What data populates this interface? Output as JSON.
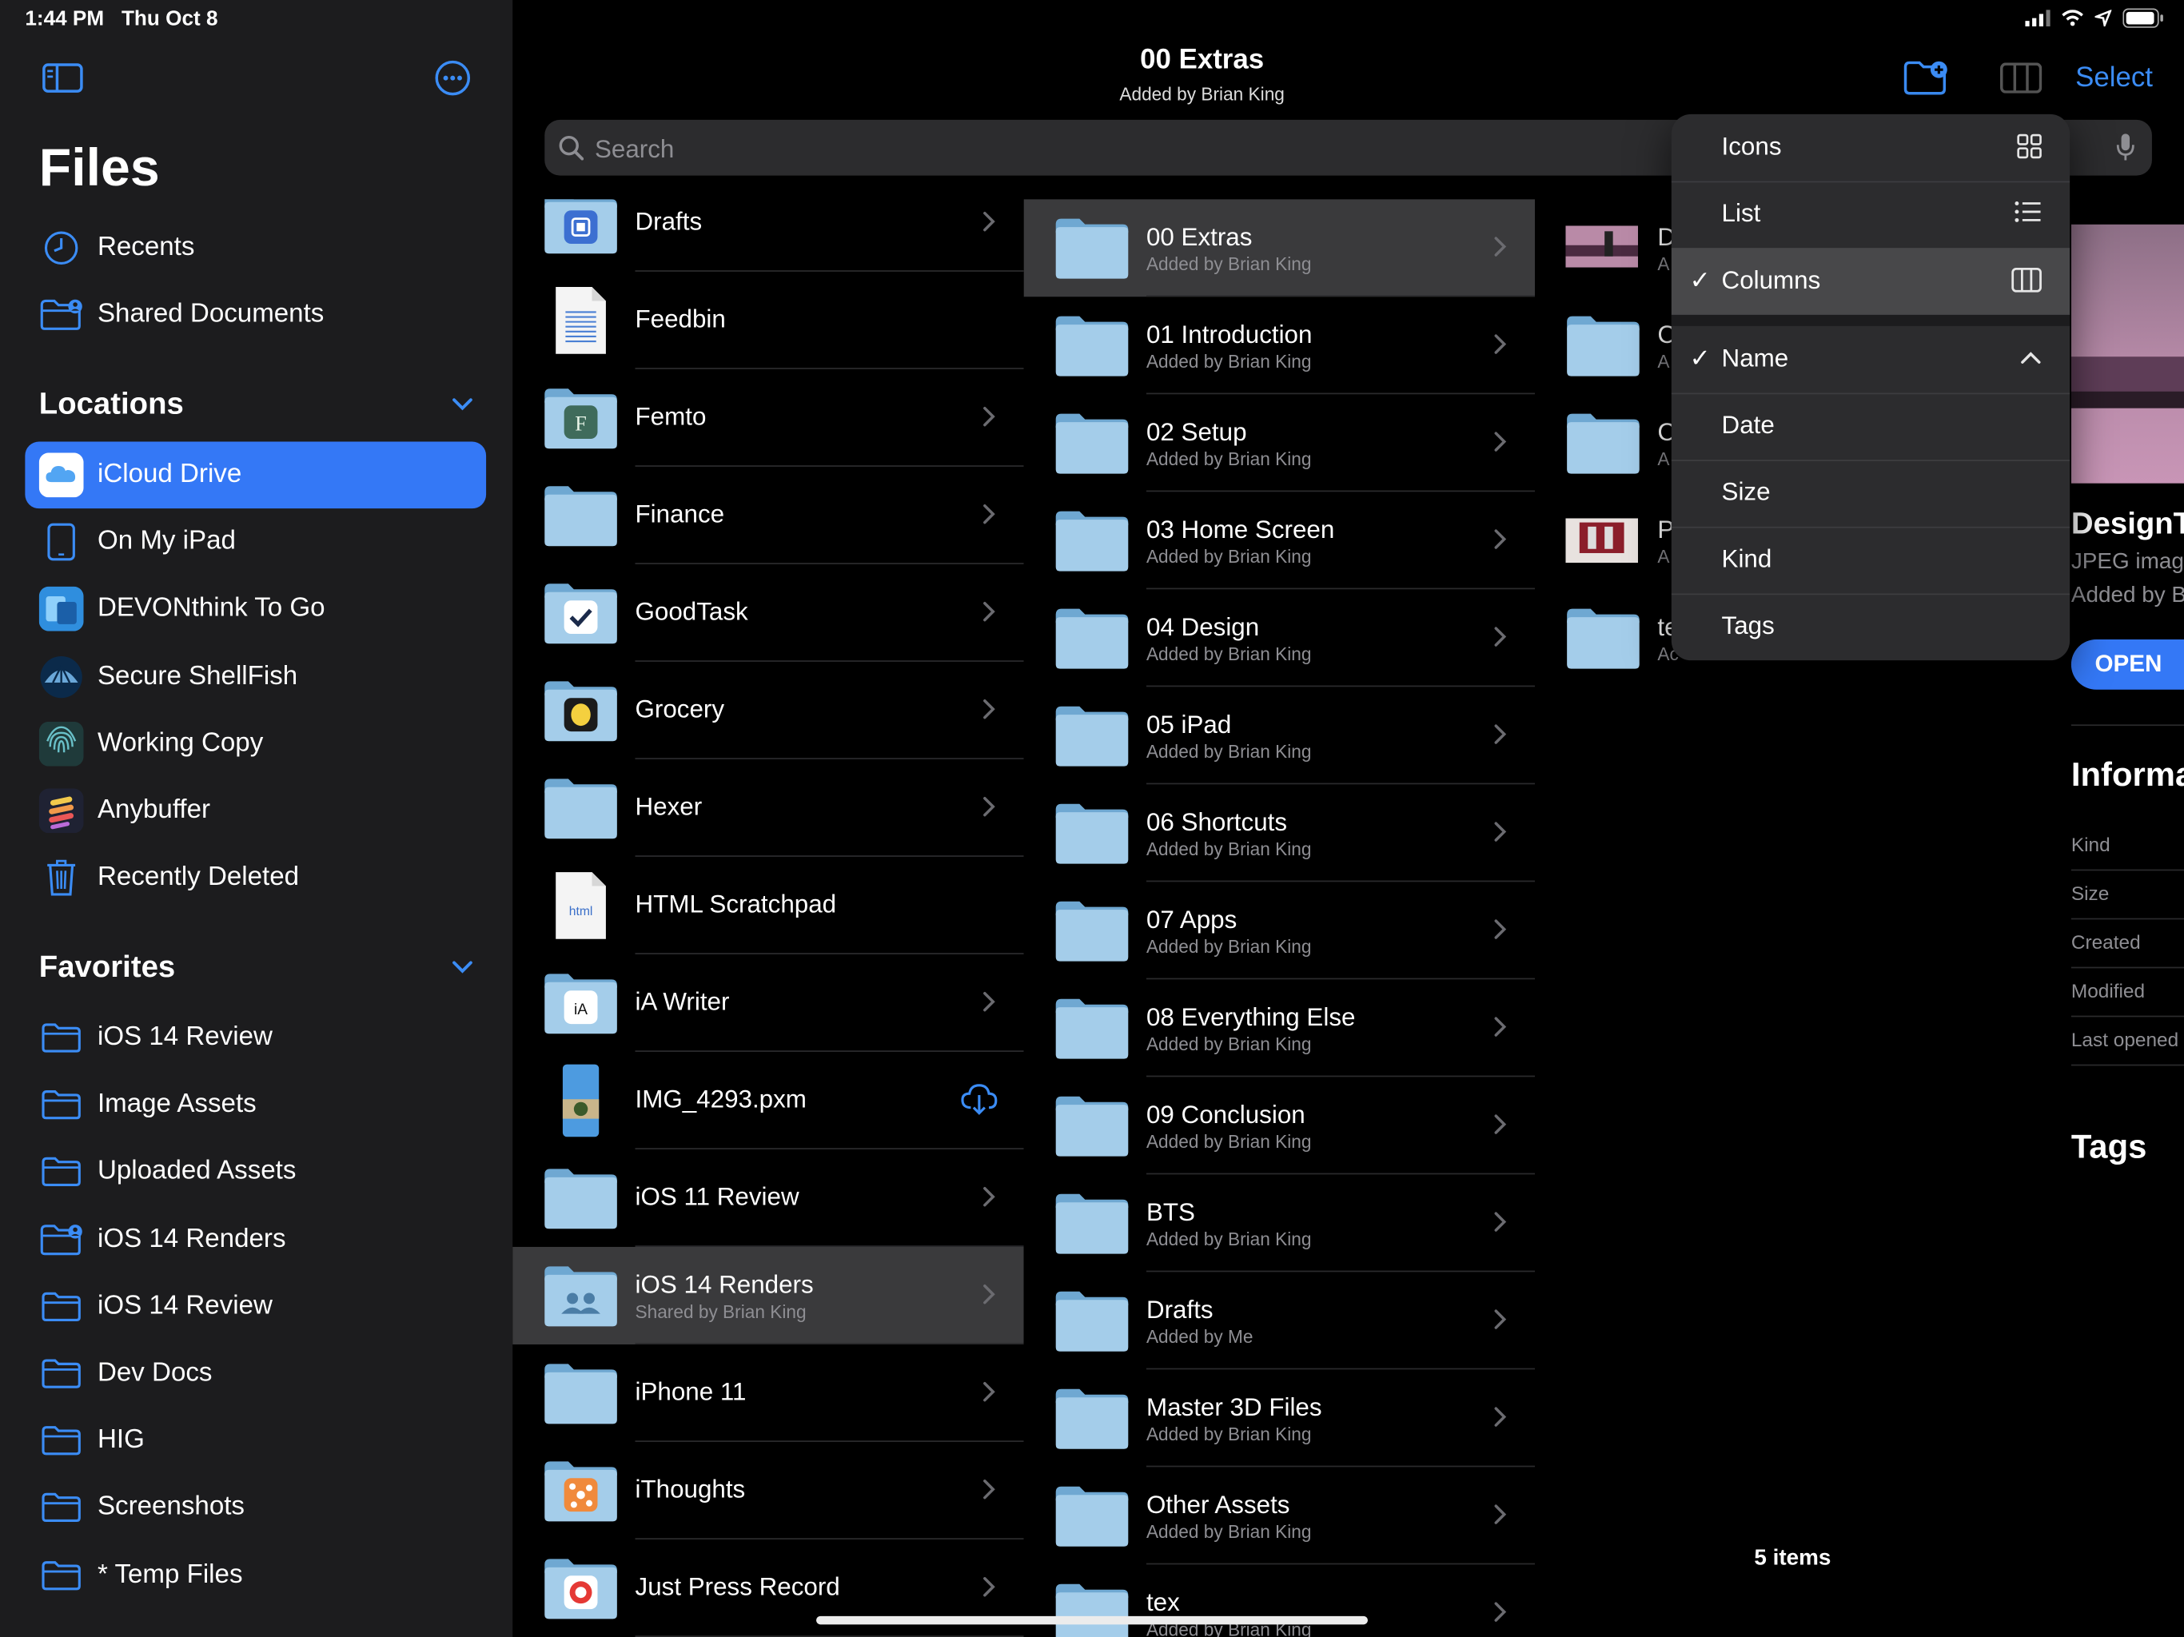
{
  "status": {
    "time": "1:44 PM",
    "date": "Thu Oct 8"
  },
  "sidebar": {
    "title": "Files",
    "top_items": [
      {
        "label": "Recents",
        "icon": "clock-icon"
      },
      {
        "label": "Shared Documents",
        "icon": "shared-folder-icon"
      }
    ],
    "locations_title": "Locations",
    "locations": [
      {
        "label": "iCloud Drive",
        "icon": "icloud-icon",
        "selected": true
      },
      {
        "label": "On My iPad",
        "icon": "ipad-icon"
      },
      {
        "label": "DEVONthink To Go",
        "icon": "devonthink-icon"
      },
      {
        "label": "Secure ShellFish",
        "icon": "shellfish-icon"
      },
      {
        "label": "Working Copy",
        "icon": "fingerprint-icon"
      },
      {
        "label": "Anybuffer",
        "icon": "anybuffer-icon"
      },
      {
        "label": "Recently Deleted",
        "icon": "trash-icon"
      }
    ],
    "favorites_title": "Favorites",
    "favorites": [
      {
        "label": "iOS 14 Review",
        "icon": "folder-icon"
      },
      {
        "label": "Image Assets",
        "icon": "folder-icon"
      },
      {
        "label": "Uploaded Assets",
        "icon": "folder-icon"
      },
      {
        "label": "iOS 14 Renders",
        "icon": "shared-folder-icon"
      },
      {
        "label": "iOS 14 Review",
        "icon": "folder-icon"
      },
      {
        "label": "Dev Docs",
        "icon": "folder-icon"
      },
      {
        "label": "HIG",
        "icon": "folder-icon"
      },
      {
        "label": "Screenshots",
        "icon": "folder-icon"
      },
      {
        "label": "* Temp Files",
        "icon": "folder-icon"
      }
    ]
  },
  "header": {
    "title": "00 Extras",
    "subtitle": "Added by Brian King",
    "select_label": "Select",
    "search_placeholder": "Search"
  },
  "column1": [
    {
      "name": "Drafts",
      "type": "app-folder",
      "badge": "drafts"
    },
    {
      "name": "Feedbin",
      "type": "doc"
    },
    {
      "name": "Femto",
      "type": "app-folder",
      "badge": "femto"
    },
    {
      "name": "Finance",
      "type": "folder"
    },
    {
      "name": "GoodTask",
      "type": "app-folder",
      "badge": "goodtask"
    },
    {
      "name": "Grocery",
      "type": "app-folder",
      "badge": "grocery"
    },
    {
      "name": "Hexer",
      "type": "folder"
    },
    {
      "name": "HTML Scratchpad",
      "type": "html-doc",
      "doc_label": "html"
    },
    {
      "name": "iA Writer",
      "type": "app-folder",
      "badge": "ia"
    },
    {
      "name": "IMG_4293.pxm",
      "type": "image-file",
      "cloud": true
    },
    {
      "name": "iOS 11 Review",
      "type": "folder"
    },
    {
      "name": "iOS 14 Renders",
      "sub": "Shared by Brian King",
      "type": "shared-folder",
      "selected": true
    },
    {
      "name": "iPhone 11",
      "type": "folder"
    },
    {
      "name": "iThoughts",
      "type": "app-folder",
      "badge": "ithoughts"
    },
    {
      "name": "Just Press Record",
      "type": "app-folder",
      "badge": "record"
    }
  ],
  "column2": [
    {
      "name": "00 Extras",
      "sub": "Added by Brian King",
      "selected": true
    },
    {
      "name": "01 Introduction",
      "sub": "Added by Brian King"
    },
    {
      "name": "02 Setup",
      "sub": "Added by Brian King"
    },
    {
      "name": "03 Home Screen",
      "sub": "Added by Brian King"
    },
    {
      "name": "04 Design",
      "sub": "Added by Brian King"
    },
    {
      "name": "05 iPad",
      "sub": "Added by Brian King"
    },
    {
      "name": "06 Shortcuts",
      "sub": "Added by Brian King"
    },
    {
      "name": "07 Apps",
      "sub": "Added by Brian King"
    },
    {
      "name": "08 Everything Else",
      "sub": "Added by Brian King"
    },
    {
      "name": "09 Conclusion",
      "sub": "Added by Brian King"
    },
    {
      "name": "BTS",
      "sub": "Added by Brian King"
    },
    {
      "name": "Drafts",
      "sub": "Added by Me"
    },
    {
      "name": "Master 3D Files",
      "sub": "Added by Brian King"
    },
    {
      "name": "Other Assets",
      "sub": "Added by Brian King"
    },
    {
      "name": "tex",
      "sub": "Added by Brian King"
    }
  ],
  "column3": {
    "items": [
      {
        "name": "D",
        "sub": "A",
        "type": "image-pink"
      },
      {
        "name": "C",
        "sub": "A",
        "type": "folder"
      },
      {
        "name": "C",
        "sub": "A",
        "type": "folder"
      },
      {
        "name": "P",
        "sub": "A",
        "type": "image-red"
      },
      {
        "name": "te",
        "sub": "Ac",
        "type": "folder"
      }
    ],
    "count_label": "5 items"
  },
  "preview": {
    "title": "DesignT",
    "kind_line": "JPEG imag",
    "added_line": "Added by B",
    "open_label": "OPEN",
    "info_title": "Informa",
    "info_rows": [
      "Kind",
      "Size",
      "Created",
      "Modified",
      "Last opened"
    ],
    "tags_title": "Tags"
  },
  "view_menu": {
    "view_options": [
      {
        "label": "Icons",
        "icon": "grid-icon"
      },
      {
        "label": "List",
        "icon": "list-icon"
      },
      {
        "label": "Columns",
        "icon": "columns-icon",
        "checked": true
      }
    ],
    "sort_options": [
      {
        "label": "Name",
        "checked": true,
        "icon": "chevron-up-icon"
      },
      {
        "label": "Date"
      },
      {
        "label": "Size"
      },
      {
        "label": "Kind"
      },
      {
        "label": "Tags"
      }
    ],
    "checkmark": "✓"
  },
  "colors": {
    "accent": "#3478f6",
    "folder_light": "#a4cdea",
    "folder_dark": "#6fa8d2",
    "sidebar_bg": "#1c1c1e",
    "selected_row": "#3a3a3c"
  }
}
